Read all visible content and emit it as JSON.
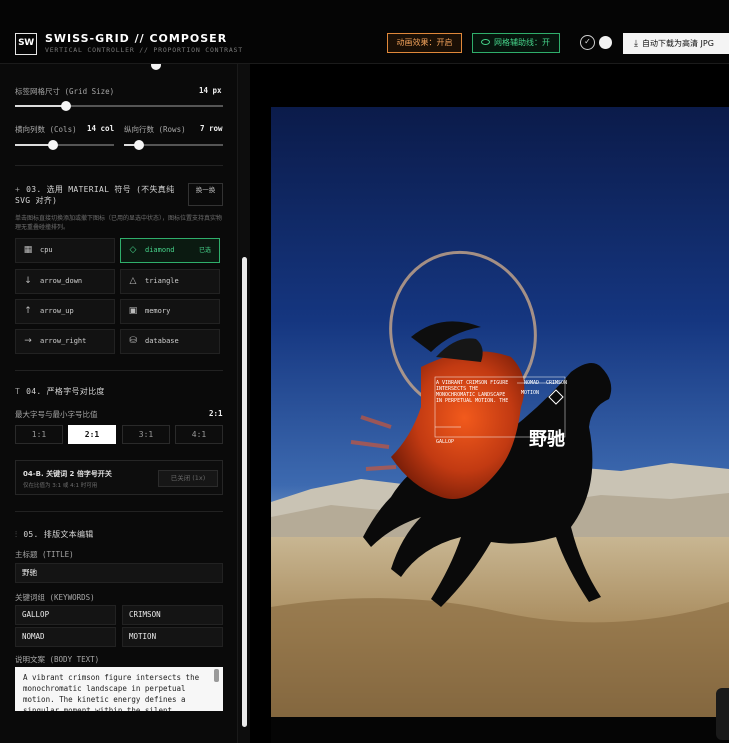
{
  "header": {
    "logo": "SW",
    "title": "SWISS-GRID // COMPOSER",
    "subtitle": "VERTICAL CONTROLLER // PROPORTION CONTRAST",
    "anim_btn": "动画效果：开启",
    "grid_btn": "网格辅助线：开",
    "download_btn": "自动下载为高清 JPG",
    "accent_orange": "#f2a25b",
    "accent_green": "#46d38a"
  },
  "grid": {
    "size_label": "标签网格尺寸 (Grid Size)",
    "size_value": "14 px",
    "size_level": 0.25,
    "cols_label": "横向列数 (Cols)",
    "cols_value": "14 col",
    "cols_level": 0.4,
    "rows_label": "纵向行数 (Rows)",
    "rows_value": "7 row",
    "rows_level": 0.15
  },
  "symbols": {
    "title": "03. 选用 MATERIAL 符号 (不失真纯 SVG 对齐)",
    "swap_label": "换一换",
    "hint": "单击图标直接切换添加或撤下图标（已用的显选中状态），图标位置支持真实物理无重叠碰撞排列。",
    "selected_tag": "已选",
    "items": [
      {
        "name": "cpu",
        "icon": "cpu-icon",
        "glyph": "▦"
      },
      {
        "name": "diamond",
        "icon": "diamond-icon",
        "glyph": "◇"
      },
      {
        "name": "arrow_down",
        "icon": "arrow-down-icon",
        "glyph": "↓"
      },
      {
        "name": "triangle",
        "icon": "triangle-icon",
        "glyph": "△"
      },
      {
        "name": "arrow_up",
        "icon": "arrow-up-icon",
        "glyph": "↑"
      },
      {
        "name": "memory",
        "icon": "memory-icon",
        "glyph": "▣"
      },
      {
        "name": "arrow_right",
        "icon": "arrow-right-icon",
        "glyph": "→"
      },
      {
        "name": "database",
        "icon": "database-icon",
        "glyph": "⛁"
      }
    ]
  },
  "typography": {
    "title": "04. 严格字号对比度",
    "ratio_label": "最大字号与最小字号比值",
    "ratio_value": "2:1",
    "ratios": [
      "1:1",
      "2:1",
      "3:1",
      "4:1"
    ],
    "toggle_title": "04-B. 关键词 2 倍字号开关",
    "toggle_hint": "仅在比值为 3:1 或 4:1 时可用",
    "toggle_btn": "已关闭 (1x)"
  },
  "layout_text": {
    "title": "05. 排版文本编辑",
    "title_label": "主标题 (TITLE)",
    "title_value": "野驰",
    "keywords_label": "关键词组 (KEYWORDS)",
    "keywords": [
      "GALLOP",
      "CRIMSON",
      "NOMAD",
      "MOTION"
    ],
    "body_label": "说明文案 (BODY TEXT)",
    "body_value": "A vibrant crimson figure intersects the monochromatic landscape in perpetual motion. The kinetic energy defines a singular moment within the silent"
  },
  "preview": {
    "overlay_body": "A VIBRANT CRIMSON FIGURE\nINTERSECTS THE\nMONOCHROMATIC LANDSCAPE\nIN PERPETUAL MOTION. THE",
    "kw_nomad": "NOMAD",
    "kw_crimson": "CRIMSON",
    "kw_motion": "MOTION",
    "kw_gallop": "GALLOP",
    "title": "野驰"
  }
}
